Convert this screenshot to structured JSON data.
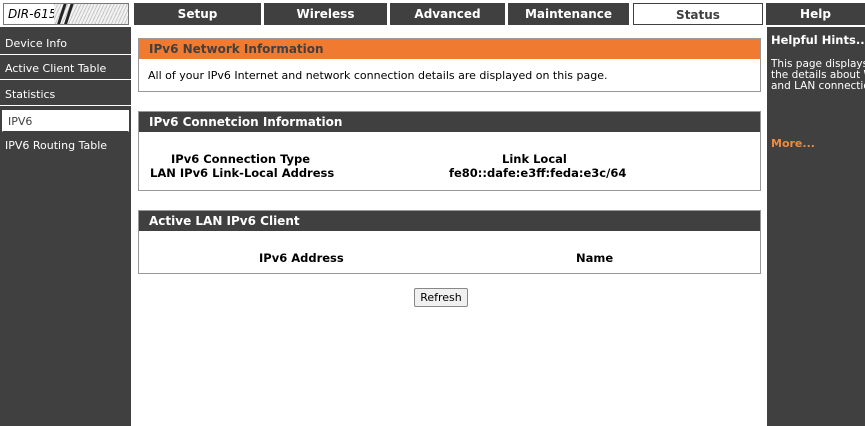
{
  "header": {
    "model": "DIR-615",
    "tabs": [
      {
        "label": "Setup"
      },
      {
        "label": "Wireless"
      },
      {
        "label": "Advanced"
      },
      {
        "label": "Maintenance"
      },
      {
        "label": "Status",
        "active": true
      },
      {
        "label": "Help"
      }
    ]
  },
  "sidebar": {
    "items": [
      {
        "label": "Device Info"
      },
      {
        "label": "Active Client Table"
      },
      {
        "label": "Statistics"
      },
      {
        "label": "IPV6",
        "active": true
      },
      {
        "label": "IPV6 Routing Table"
      }
    ]
  },
  "help": {
    "title": "Helpful Hints...",
    "text": "This page displays all the details about WAN and LAN connection.",
    "more": "More..."
  },
  "ipv6_info": {
    "title": "IPv6 Network Information",
    "description": "All of your IPv6 Internet and network connection details are displayed on this page."
  },
  "connection": {
    "title": "IPv6 Connetcion Information",
    "rows": [
      {
        "label": "IPv6 Connection Type",
        "value": "Link Local"
      },
      {
        "label": "LAN IPv6 Link-Local Address",
        "value": "fe80::dafe:e3ff:feda:e3c/64"
      }
    ]
  },
  "clients": {
    "title": "Active LAN IPv6 Client",
    "columns": [
      "IPv6 Address",
      "Name"
    ]
  },
  "actions": {
    "refresh_label": "Refresh"
  },
  "colors": {
    "dark": "#404040",
    "accent_orange": "#f07a30",
    "link_orange": "#f08a3c"
  }
}
